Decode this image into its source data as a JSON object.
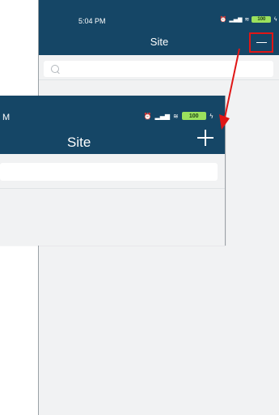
{
  "back_screen": {
    "time": "5:04 PM",
    "title": "Site",
    "status_icons": [
      "alarm-icon",
      "signal-icon",
      "wifi-icon",
      "battery-icon",
      "charging-icon"
    ],
    "battery_level": "100",
    "header_color": "#154666",
    "highlight_color": "#e01616"
  },
  "front_screen": {
    "time_fragment": "M",
    "title": "Site",
    "status_icons": [
      "alarm-icon",
      "signal-icon",
      "wifi-icon",
      "battery-icon",
      "charging-icon"
    ],
    "battery_level": "100"
  },
  "colors": {
    "battery": "#9be15d",
    "annotation": "#e01616",
    "background": "#f1f2f3"
  }
}
